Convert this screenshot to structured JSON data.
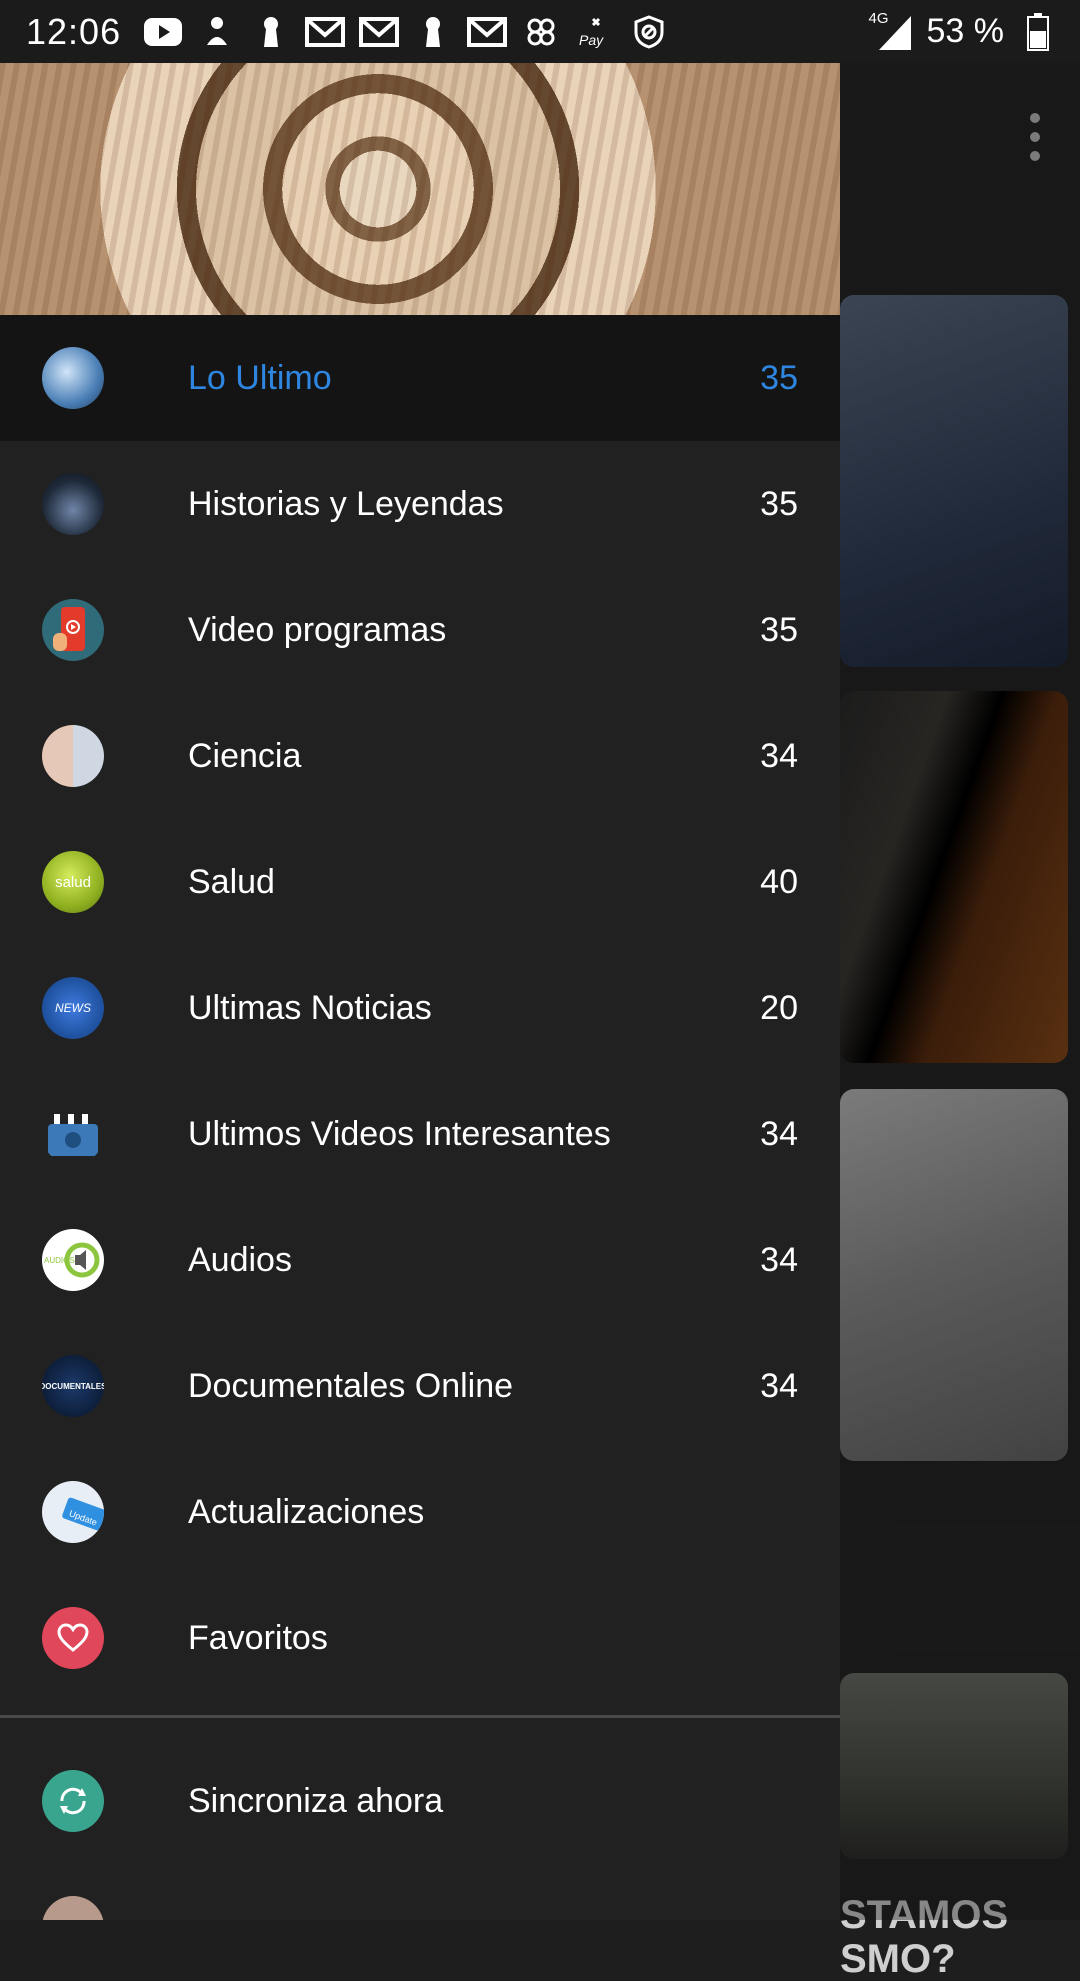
{
  "status_bar": {
    "time": "12:06",
    "signal_label": "4G",
    "battery": "53 %",
    "icons": [
      "youtube-icon",
      "notification-icon",
      "keyhole-icon",
      "gmail-icon",
      "gmail-icon",
      "keyhole-icon",
      "gmail-icon",
      "pinwheel-icon",
      "caixa-pay-icon",
      "block-icon"
    ]
  },
  "drawer": {
    "menu": [
      {
        "label": "Lo Ultimo",
        "count": "35",
        "active": true,
        "avatar": {
          "color": "#4b7fb6",
          "icon": "lo-ultimo-icon"
        }
      },
      {
        "label": "Historias y Leyendas",
        "count": "35",
        "active": false,
        "avatar": {
          "color": "#1f2a3a",
          "icon": "historias-icon"
        }
      },
      {
        "label": "Video programas",
        "count": "35",
        "active": false,
        "avatar": {
          "color": "#2f6b78",
          "icon": "video-programas-icon"
        }
      },
      {
        "label": "Ciencia",
        "count": "34",
        "active": false,
        "avatar": {
          "color": "#cfcfcf",
          "icon": "ciencia-icon"
        }
      },
      {
        "label": "Salud",
        "count": "40",
        "active": false,
        "avatar": {
          "color": "#9cbc2a",
          "icon": "salud-icon",
          "text": "salud"
        }
      },
      {
        "label": "Ultimas Noticias",
        "count": "20",
        "active": false,
        "avatar": {
          "color": "#1d4f9b",
          "icon": "news-icon",
          "text": "NEWS"
        }
      },
      {
        "label": "Ultimos Videos Interesantes",
        "count": "34",
        "active": false,
        "avatar": {
          "color": "#3b79b8",
          "icon": "clapperboard-icon"
        }
      },
      {
        "label": "Audios",
        "count": "34",
        "active": false,
        "avatar": {
          "color": "#ffffff",
          "icon": "speaker-icon"
        }
      },
      {
        "label": "Documentales Online",
        "count": "34",
        "active": false,
        "avatar": {
          "color": "#0d1e3a",
          "icon": "documentales-icon",
          "text": "DOCUMENTALES"
        }
      },
      {
        "label": "Actualizaciones",
        "count": "",
        "active": false,
        "avatar": {
          "color": "#e8eef5",
          "icon": "update-icon"
        }
      },
      {
        "label": "Favoritos",
        "count": "",
        "active": false,
        "avatar": {
          "color": "#e0475a",
          "icon": "heart-icon"
        }
      }
    ],
    "secondary": [
      {
        "label": "Sincroniza ahora",
        "avatar": {
          "color": "#3aa58f",
          "icon": "sync-icon"
        }
      }
    ]
  },
  "background": {
    "headline_partial_1": "STAMOS",
    "headline_partial_2": "SMO?"
  }
}
